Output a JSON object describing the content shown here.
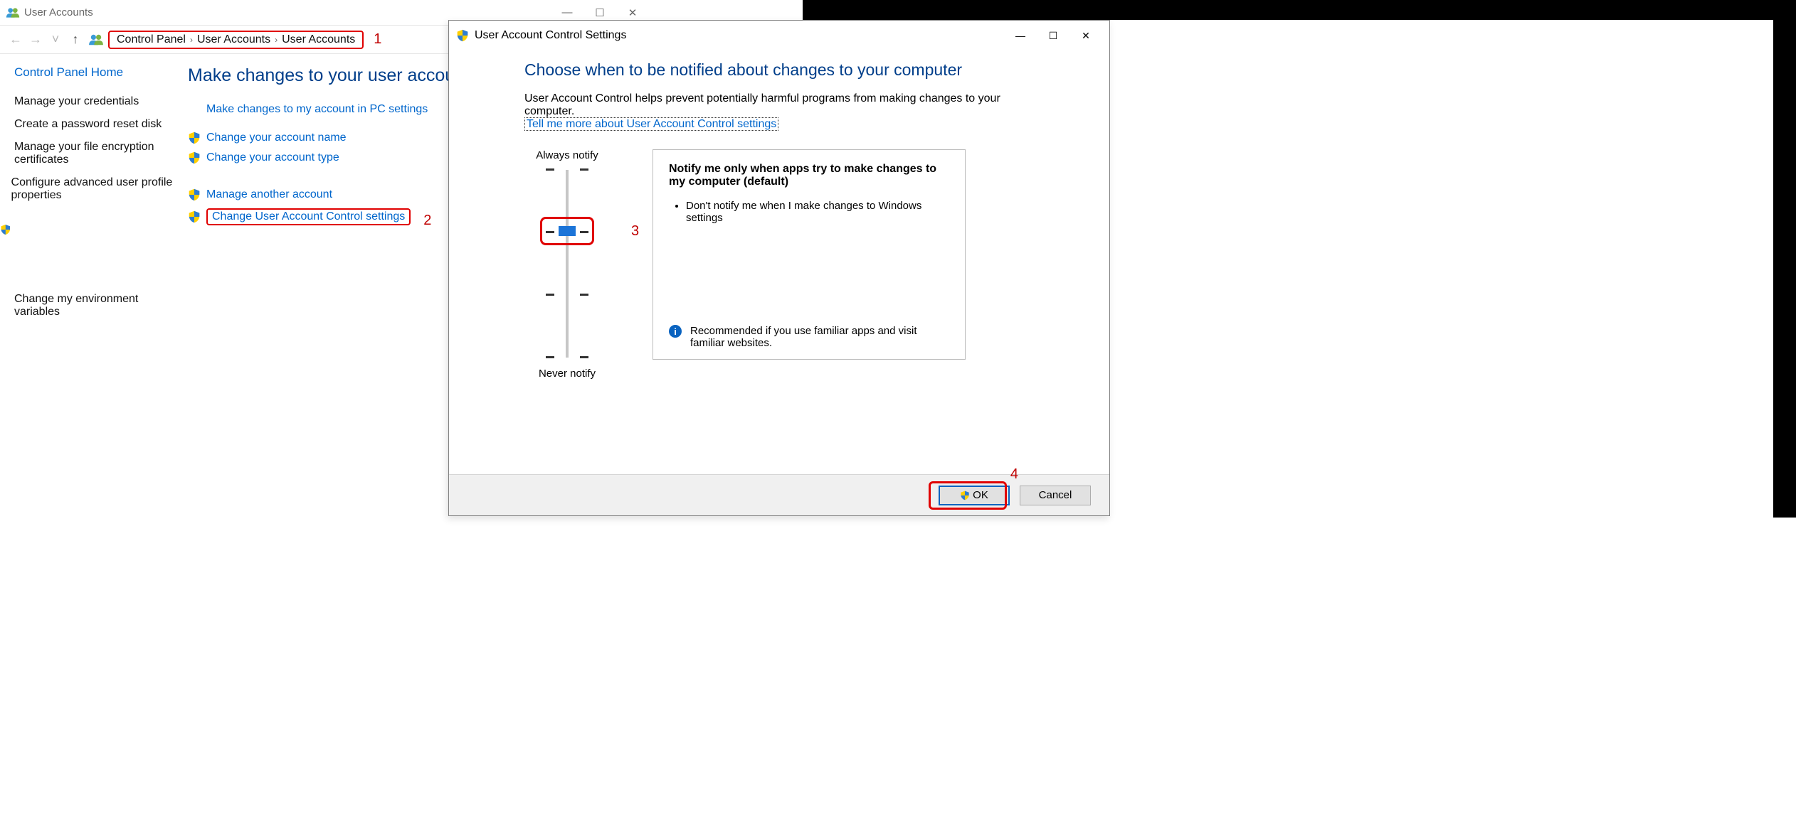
{
  "cp": {
    "title": "User Accounts",
    "winbtns": {
      "min": "—",
      "max": "☐",
      "close": "✕"
    },
    "nav": {
      "back": "←",
      "fwd": "→",
      "dd": "˅",
      "up": "↑"
    },
    "breadcrumbs": [
      "Control Panel",
      "User Accounts",
      "User Accounts"
    ],
    "callouts": {
      "one": "1",
      "two": "2"
    },
    "side": {
      "home": "Control Panel Home",
      "links": [
        "Manage your credentials",
        "Create a password reset disk",
        "Manage your file encryption certificates",
        "Configure advanced user profile properties",
        "Change my environment variables"
      ]
    },
    "main": {
      "heading": "Make changes to your user account",
      "pc_link": "Make changes to my account in PC settings",
      "acct_name": "Change your account name",
      "acct_type": "Change your account type",
      "manage_another": "Manage another account",
      "change_uac": "Change User Account Control settings"
    }
  },
  "uac": {
    "title": "User Account Control Settings",
    "winbtns": {
      "min": "—",
      "max": "☐",
      "close": "✕"
    },
    "heading": "Choose when to be notified about changes to your computer",
    "para": "User Account Control helps prevent potentially harmful programs from making changes to your computer.",
    "more_link": "Tell me more about User Account Control settings",
    "slider_top": "Always notify",
    "slider_bottom": "Never notify",
    "desc_title": "Notify me only when apps try to make changes to my computer (default)",
    "desc_bullet": "Don't notify me when I make changes to Windows settings",
    "desc_info": "Recommended if you use familiar apps and visit familiar websites.",
    "ok": "OK",
    "cancel": "Cancel",
    "callouts": {
      "three": "3",
      "four": "4"
    },
    "slider_level": 2
  }
}
